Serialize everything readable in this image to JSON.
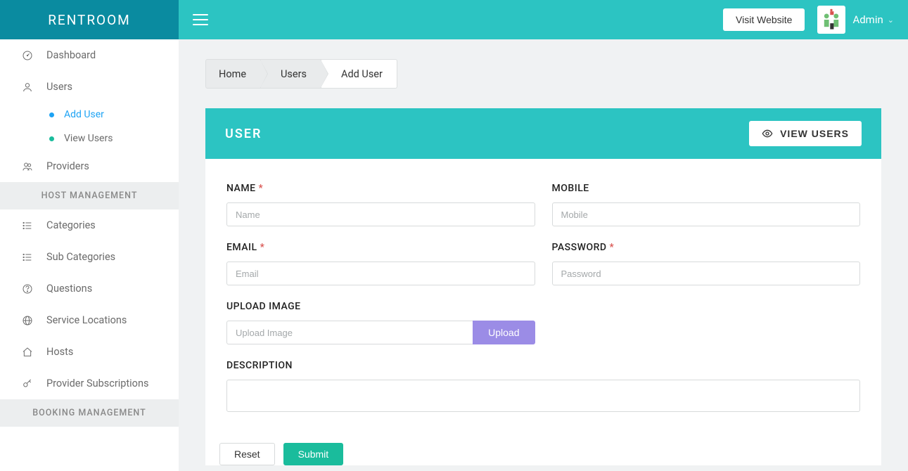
{
  "brand": "RENTROOM",
  "header": {
    "visit_website": "Visit Website",
    "user_label": "Admin"
  },
  "sidebar": {
    "dashboard": "Dashboard",
    "users": "Users",
    "users_sub": {
      "add": "Add User",
      "view": "View Users"
    },
    "providers": "Providers",
    "section_host": "HOST MANAGEMENT",
    "categories": "Categories",
    "sub_categories": "Sub Categories",
    "questions": "Questions",
    "service_locations": "Service Locations",
    "hosts": "Hosts",
    "provider_subscriptions": "Provider Subscriptions",
    "section_booking": "BOOKING MANAGEMENT"
  },
  "breadcrumb": {
    "home": "Home",
    "users": "Users",
    "add_user": "Add User"
  },
  "card": {
    "title": "USER",
    "view_users_btn": "VIEW USERS"
  },
  "form": {
    "name_label": "NAME",
    "name_ph": "Name",
    "mobile_label": "MOBILE",
    "mobile_ph": "Mobile",
    "email_label": "EMAIL",
    "email_ph": "Email",
    "password_label": "PASSWORD",
    "password_ph": "Password",
    "upload_label": "UPLOAD IMAGE",
    "upload_ph": "Upload Image",
    "upload_btn": "Upload",
    "description_label": "DESCRIPTION",
    "reset": "Reset",
    "submit": "Submit",
    "required_mark": "*"
  }
}
